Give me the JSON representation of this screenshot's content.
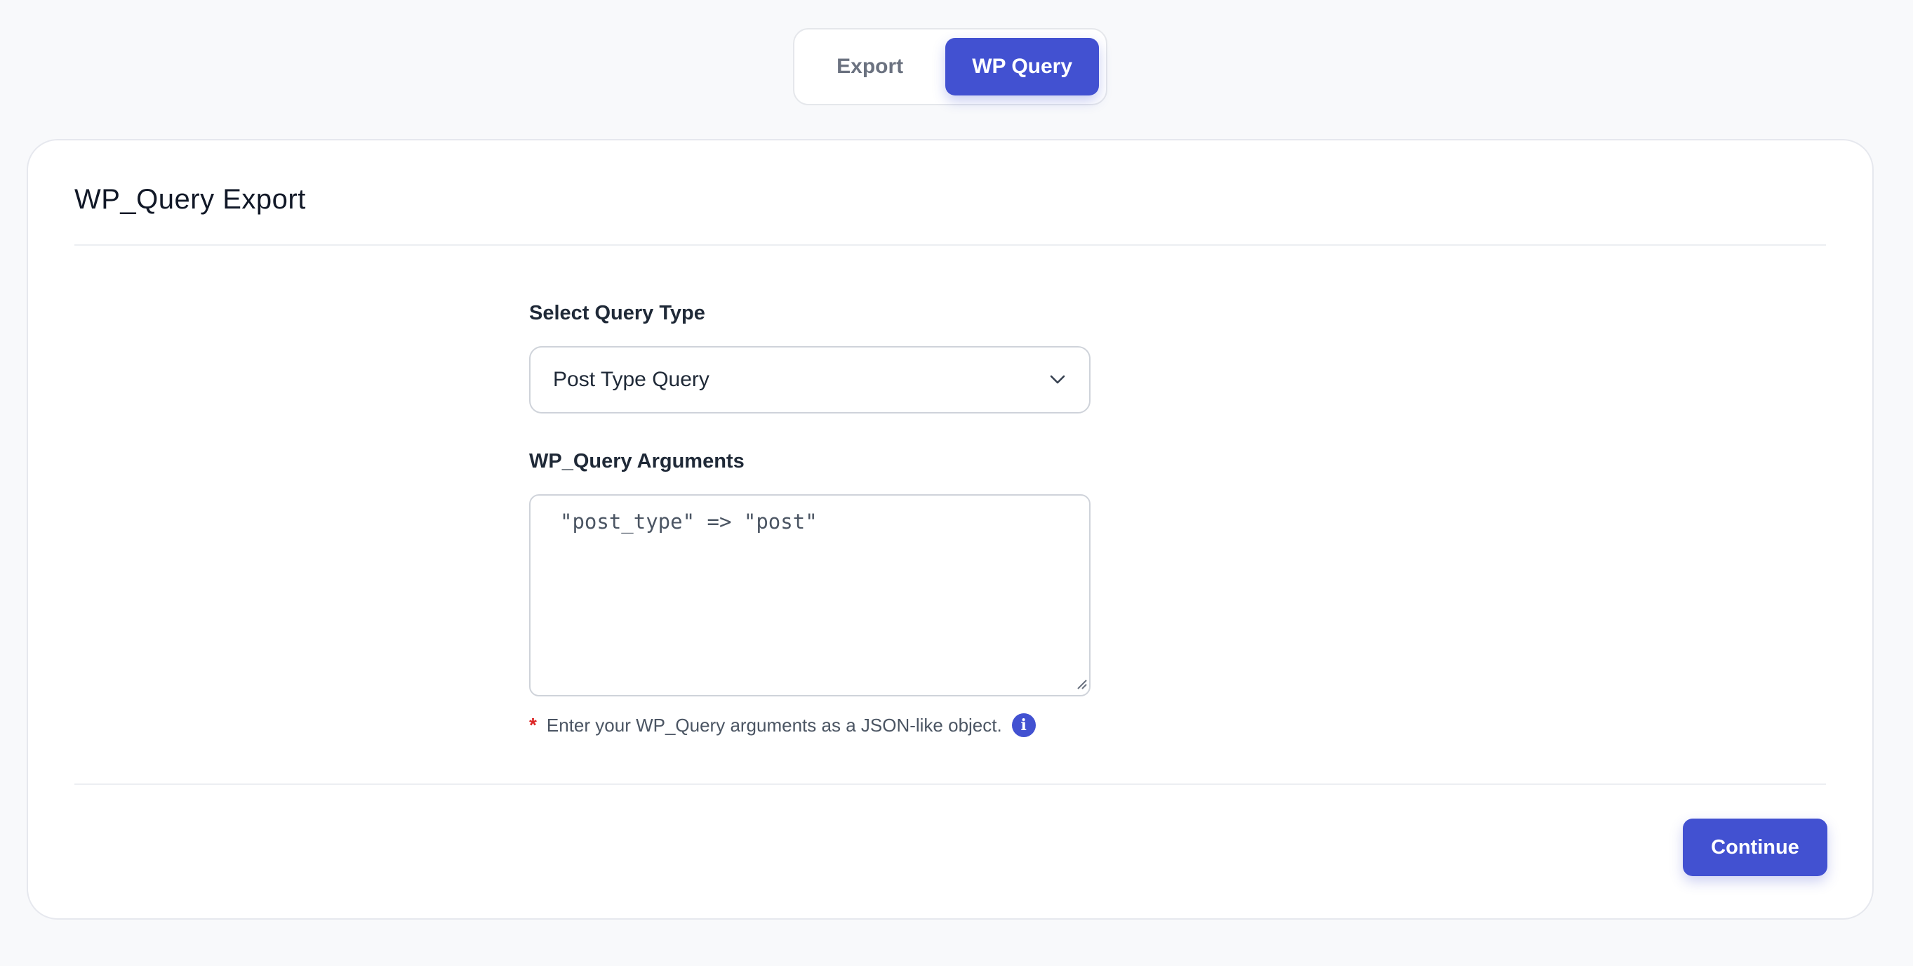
{
  "tabs": {
    "export_label": "Export",
    "wp_query_label": "WP Query",
    "active": "WP Query"
  },
  "card": {
    "title": "WP_Query Export"
  },
  "form": {
    "query_type_label": "Select Query Type",
    "query_type_value": "Post Type Query",
    "arguments_label": "WP_Query Arguments",
    "arguments_value": "\"post_type\" => \"post\"",
    "hint_star": "*",
    "hint_text": "Enter your WP_Query arguments as a JSON-like object.",
    "info_glyph": "i"
  },
  "actions": {
    "continue_label": "Continue"
  },
  "colors": {
    "accent": "#4251d1",
    "background": "#f8f9fb",
    "required": "#dc2626"
  },
  "icons": {
    "select_arrow": "chevron-down-icon",
    "info": "info-icon",
    "resize": "resize-grip-icon"
  }
}
